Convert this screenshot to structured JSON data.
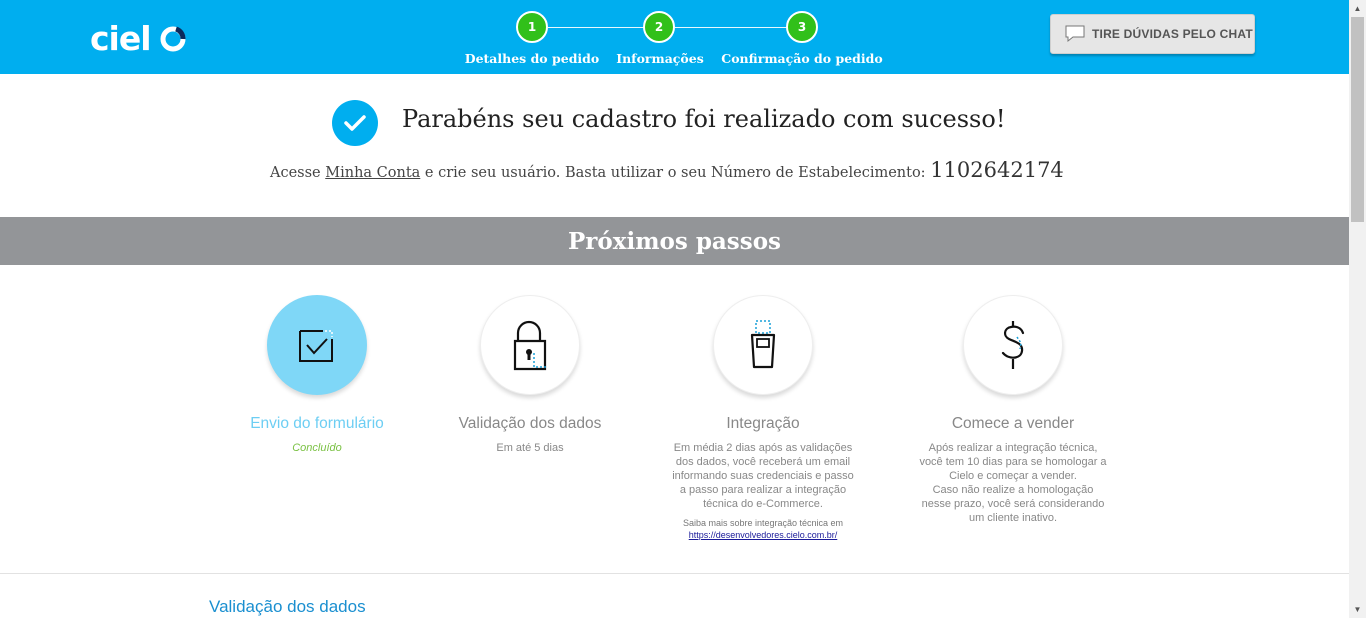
{
  "header": {
    "logo_text": "cielo",
    "chat_button": "TIRE DÚVIDAS PELO CHAT",
    "steps": [
      {
        "number": "1",
        "label": "Detalhes do pedido"
      },
      {
        "number": "2",
        "label": "Informações"
      },
      {
        "number": "3",
        "label": "Confirmação do pedido"
      }
    ],
    "colors": {
      "background": "#00aeef",
      "step_circle": "#31c01a"
    }
  },
  "success": {
    "title": "Parabéns seu cadastro foi realizado com sucesso!",
    "sub_prefix": "Acesse ",
    "sub_link": "Minha Conta",
    "sub_middle": " e crie seu usuário. Basta utilizar o seu Número de Estabelecimento: ",
    "establishment_number": "1102642174"
  },
  "next_steps": {
    "title": "Próximos passos",
    "cards": [
      {
        "icon": "checkbox-icon",
        "title": "Envio do formulário",
        "subtitle": "Concluído",
        "active": true
      },
      {
        "icon": "lock-icon",
        "title": "Validação dos dados",
        "subtitle": "Em até 5 dias"
      },
      {
        "icon": "terminal-icon",
        "title": "Integração",
        "subtitle": "Em média 2 dias após as validações dos dados, você receberá um email informando suas credenciais e passo a passo para realizar a integração técnica do e-Commerce.",
        "note": "Saiba mais sobre integração técnica em",
        "link": "https://desenvolvedores.cielo.com.br/"
      },
      {
        "icon": "dollar-icon",
        "title": "Comece a vender",
        "subtitle": "Após realizar a integração técnica, você tem 10 dias para se homologar a Cielo e começar a vender.",
        "subtitle2": "Caso não realize a homologação nesse prazo, você será considerando um cliente inativo."
      }
    ]
  },
  "section": {
    "title": "Validação dos dados"
  }
}
